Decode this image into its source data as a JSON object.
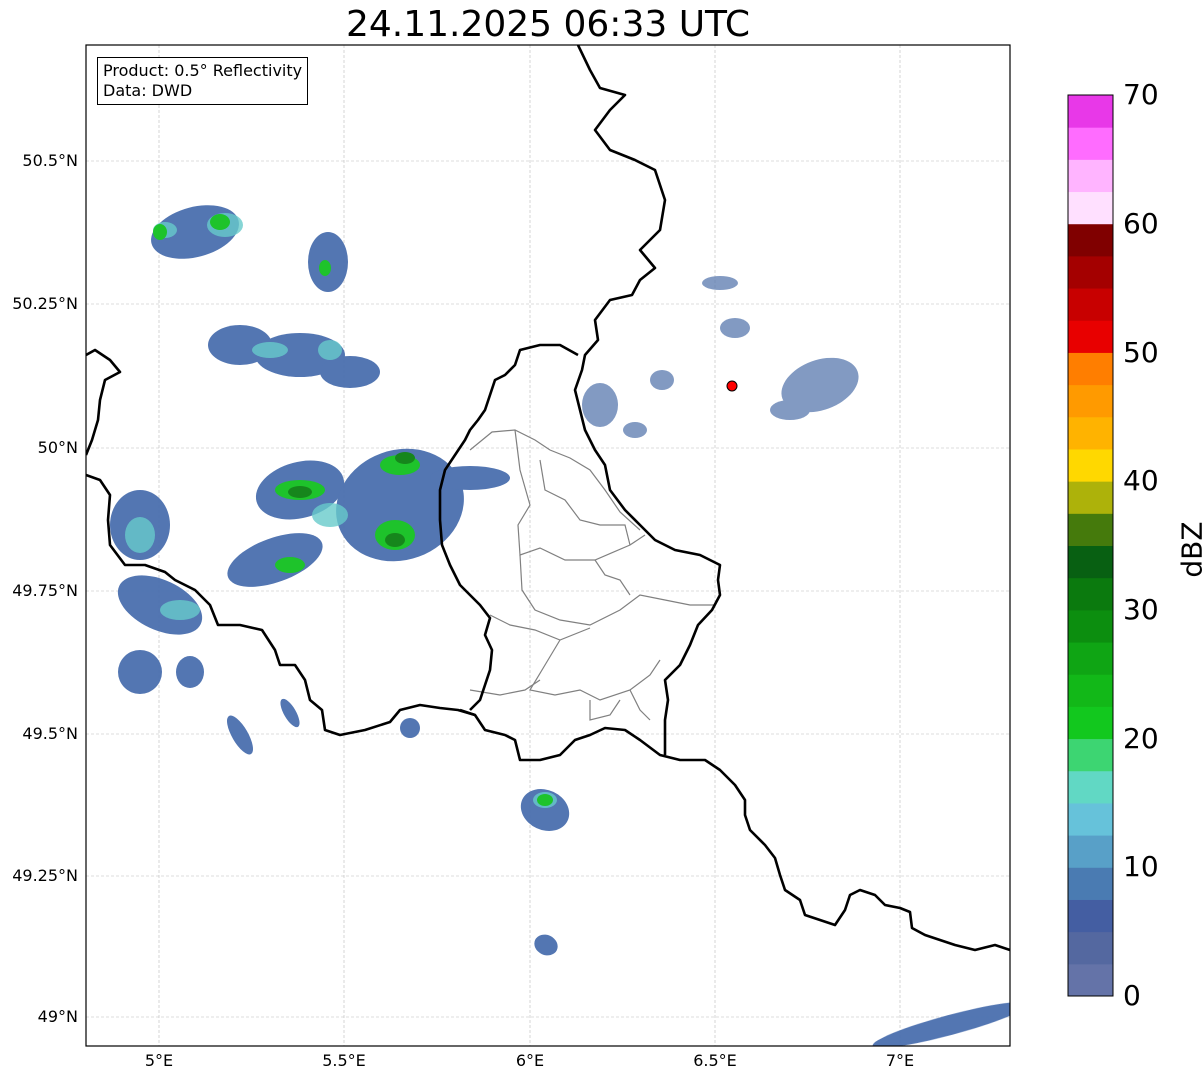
{
  "title": "24.11.2025 06:33 UTC",
  "info": {
    "product": "Product: 0.5° Reflectivity",
    "source": "Data: DWD"
  },
  "map": {
    "lon_range": [
      4.8,
      7.3
    ],
    "lat_range": [
      48.95,
      50.7
    ],
    "lon_ticks": [
      "5°E",
      "5.5°E",
      "6°E",
      "6.5°E",
      "7°E"
    ],
    "lat_ticks": [
      "50.5°N",
      "50.25°N",
      "50°N",
      "49.75°N",
      "49.5°N",
      "49.25°N",
      "49°N"
    ],
    "grid": true,
    "radar_site_color": "#ff0000",
    "borders_color": "#000000",
    "districts_color": "#808080"
  },
  "colorbar": {
    "label": "dBZ",
    "ticks": [
      "0",
      "10",
      "20",
      "30",
      "40",
      "50",
      "60",
      "70"
    ],
    "range": [
      0,
      70
    ],
    "colors": [
      "#6473a8",
      "#5468a0",
      "#445ea2",
      "#4a7bb2",
      "#58a0c8",
      "#66c2da",
      "#61d8c4",
      "#3dd572",
      "#12c81e",
      "#12b818",
      "#0fa514",
      "#0c8e0f",
      "#0b7a0e",
      "#086012",
      "#457a0c",
      "#adb20a",
      "#ffd800",
      "#ffb300",
      "#ff9a00",
      "#ff7e00",
      "#e80000",
      "#c80000",
      "#a40000",
      "#800000",
      "#ffe0ff",
      "#ffb4ff",
      "#ff6cff",
      "#e838e8"
    ]
  }
}
